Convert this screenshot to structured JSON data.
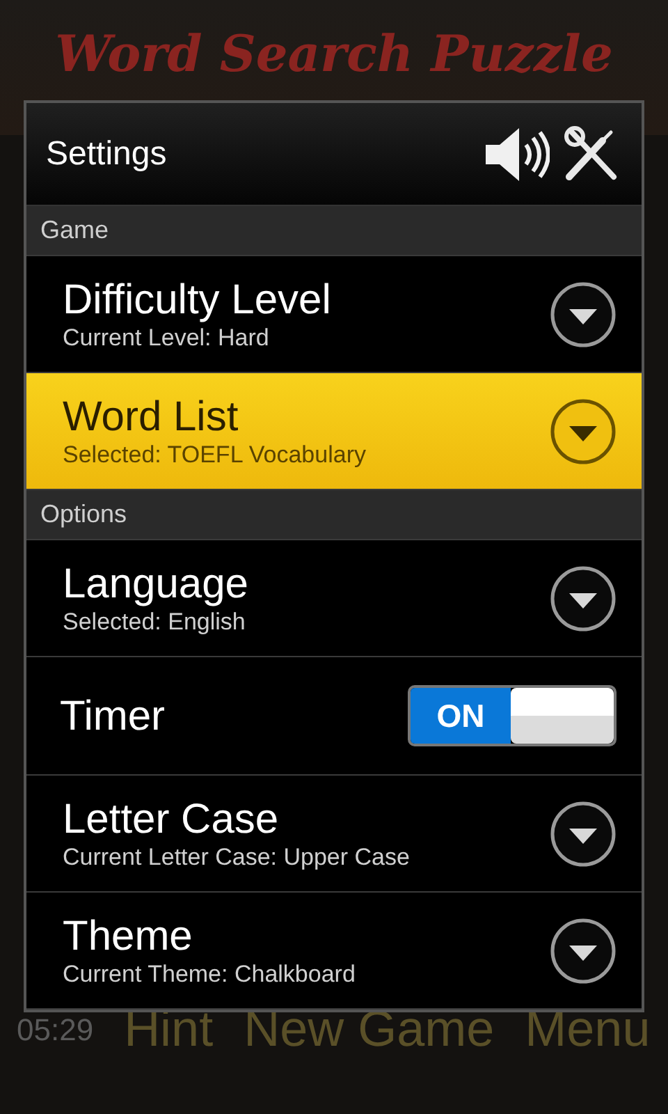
{
  "app": {
    "title": "Word Search Puzzle",
    "timer": "05:29",
    "actions": [
      "Hint",
      "New Game",
      "Menu"
    ]
  },
  "dialog": {
    "title": "Settings",
    "sound_on": true,
    "sections": [
      {
        "header": "Game",
        "items": [
          {
            "kind": "select",
            "title": "Difficulty Level",
            "subtitle": "Current Level: Hard",
            "selected": false
          },
          {
            "kind": "select",
            "title": "Word List",
            "subtitle": "Selected: TOEFL Vocabulary",
            "selected": true
          }
        ]
      },
      {
        "header": "Options",
        "items": [
          {
            "kind": "select",
            "title": "Language",
            "subtitle": "Selected: English",
            "selected": false
          },
          {
            "kind": "toggle",
            "title": "Timer",
            "on": true,
            "label": "ON",
            "selected": false
          },
          {
            "kind": "select",
            "title": "Letter Case",
            "subtitle": "Current Letter Case: Upper Case",
            "selected": false
          },
          {
            "kind": "select",
            "title": "Theme",
            "subtitle": "Current Theme: Chalkboard",
            "selected": false
          }
        ]
      }
    ]
  }
}
